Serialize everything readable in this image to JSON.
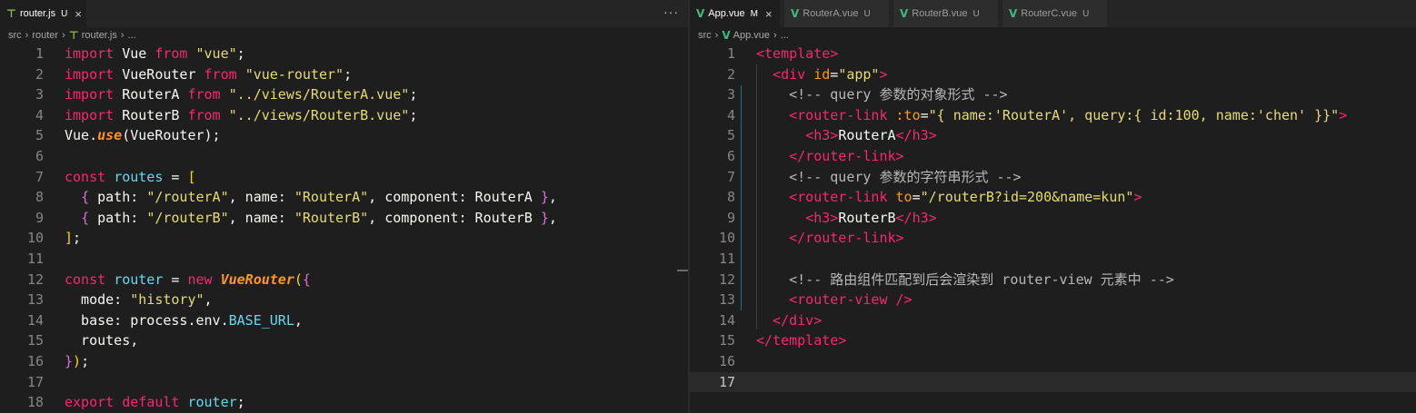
{
  "left": {
    "tabs": [
      {
        "name": "router.js",
        "status": "U",
        "active": true,
        "icon": "js-file-icon"
      }
    ],
    "more": "···",
    "breadcrumb": [
      "src",
      "router",
      "router.js",
      "..."
    ],
    "lines": [
      [
        {
          "t": "import",
          "c": "k"
        },
        {
          "t": " Vue ",
          "c": "v"
        },
        {
          "t": "from",
          "c": "k"
        },
        {
          "t": " ",
          "c": "v"
        },
        {
          "t": "\"vue\"",
          "c": "s"
        },
        {
          "t": ";",
          "c": "p"
        }
      ],
      [
        {
          "t": "import",
          "c": "k"
        },
        {
          "t": " VueRouter ",
          "c": "v"
        },
        {
          "t": "from",
          "c": "k"
        },
        {
          "t": " ",
          "c": "v"
        },
        {
          "t": "\"vue-router\"",
          "c": "s"
        },
        {
          "t": ";",
          "c": "p"
        }
      ],
      [
        {
          "t": "import",
          "c": "k"
        },
        {
          "t": " RouterA ",
          "c": "v"
        },
        {
          "t": "from",
          "c": "k"
        },
        {
          "t": " ",
          "c": "v"
        },
        {
          "t": "\"../views/RouterA.vue\"",
          "c": "s"
        },
        {
          "t": ";",
          "c": "p"
        }
      ],
      [
        {
          "t": "import",
          "c": "k"
        },
        {
          "t": " RouterB ",
          "c": "v"
        },
        {
          "t": "from",
          "c": "k"
        },
        {
          "t": " ",
          "c": "v"
        },
        {
          "t": "\"../views/RouterB.vue\"",
          "c": "s"
        },
        {
          "t": ";",
          "c": "p"
        }
      ],
      [
        {
          "t": "Vue.",
          "c": "v"
        },
        {
          "t": "use",
          "c": "fn"
        },
        {
          "t": "(VueRouter);",
          "c": "p"
        }
      ],
      [],
      [
        {
          "t": "const",
          "c": "k"
        },
        {
          "t": " ",
          "c": "v"
        },
        {
          "t": "routes",
          "c": "cl"
        },
        {
          "t": " = ",
          "c": "v"
        },
        {
          "t": "[",
          "c": "br1"
        }
      ],
      [
        {
          "t": "  ",
          "c": "v"
        },
        {
          "t": "{",
          "c": "br2"
        },
        {
          "t": " path: ",
          "c": "v"
        },
        {
          "t": "\"/routerA\"",
          "c": "s"
        },
        {
          "t": ", name: ",
          "c": "v"
        },
        {
          "t": "\"RouterA\"",
          "c": "s"
        },
        {
          "t": ", component: RouterA ",
          "c": "v"
        },
        {
          "t": "}",
          "c": "br2"
        },
        {
          "t": ",",
          "c": "p"
        }
      ],
      [
        {
          "t": "  ",
          "c": "v"
        },
        {
          "t": "{",
          "c": "br2"
        },
        {
          "t": " path: ",
          "c": "v"
        },
        {
          "t": "\"/routerB\"",
          "c": "s"
        },
        {
          "t": ", name: ",
          "c": "v"
        },
        {
          "t": "\"RouterB\"",
          "c": "s"
        },
        {
          "t": ", component: RouterB ",
          "c": "v"
        },
        {
          "t": "}",
          "c": "br2"
        },
        {
          "t": ",",
          "c": "p"
        }
      ],
      [
        {
          "t": "]",
          "c": "br1"
        },
        {
          "t": ";",
          "c": "p"
        }
      ],
      [],
      [
        {
          "t": "const",
          "c": "k"
        },
        {
          "t": " ",
          "c": "v"
        },
        {
          "t": "router",
          "c": "cl"
        },
        {
          "t": " = ",
          "c": "v"
        },
        {
          "t": "new",
          "c": "k"
        },
        {
          "t": " ",
          "c": "v"
        },
        {
          "t": "VueRouter",
          "c": "fn"
        },
        {
          "t": "(",
          "c": "br1"
        },
        {
          "t": "{",
          "c": "br2"
        }
      ],
      [
        {
          "t": "  mode: ",
          "c": "v"
        },
        {
          "t": "\"history\"",
          "c": "s"
        },
        {
          "t": ",",
          "c": "p"
        }
      ],
      [
        {
          "t": "  base: process.env.",
          "c": "v"
        },
        {
          "t": "BASE_URL",
          "c": "kb"
        },
        {
          "t": ",",
          "c": "p"
        }
      ],
      [
        {
          "t": "  routes,",
          "c": "v"
        }
      ],
      [
        {
          "t": "}",
          "c": "br2"
        },
        {
          "t": ")",
          "c": "br1"
        },
        {
          "t": ";",
          "c": "p"
        }
      ],
      [],
      [
        {
          "t": "export",
          "c": "k"
        },
        {
          "t": " ",
          "c": "v"
        },
        {
          "t": "default",
          "c": "k"
        },
        {
          "t": " ",
          "c": "v"
        },
        {
          "t": "router",
          "c": "cl"
        },
        {
          "t": ";",
          "c": "p"
        }
      ]
    ]
  },
  "right": {
    "tabs": [
      {
        "name": "App.vue",
        "status": "M",
        "active": true,
        "icon": "vue-file-icon"
      },
      {
        "name": "RouterA.vue",
        "status": "U",
        "active": false,
        "icon": "vue-file-icon"
      },
      {
        "name": "RouterB.vue",
        "status": "U",
        "active": false,
        "icon": "vue-file-icon"
      },
      {
        "name": "RouterC.vue",
        "status": "U",
        "active": false,
        "icon": "vue-file-icon"
      }
    ],
    "breadcrumb": [
      "src",
      "App.vue",
      "..."
    ],
    "lines": [
      [
        {
          "t": "<template>",
          "c": "tg"
        }
      ],
      [
        {
          "t": "  ",
          "c": "v"
        },
        {
          "t": "<div",
          "c": "tg"
        },
        {
          "t": " ",
          "c": "v"
        },
        {
          "t": "id",
          "c": "at"
        },
        {
          "t": "=",
          "c": "v"
        },
        {
          "t": "\"app\"",
          "c": "s"
        },
        {
          "t": ">",
          "c": "tg"
        }
      ],
      [
        {
          "t": "    ",
          "c": "v"
        },
        {
          "t": "<!-- query 参数的对象形式 -->",
          "c": "cm"
        }
      ],
      [
        {
          "t": "    ",
          "c": "v"
        },
        {
          "t": "<router-link",
          "c": "tg"
        },
        {
          "t": " ",
          "c": "v"
        },
        {
          "t": ":to",
          "c": "at"
        },
        {
          "t": "=",
          "c": "v"
        },
        {
          "t": "\"{ name:'RouterA', query:{ id:100, name:'chen' }}\"",
          "c": "s"
        },
        {
          "t": ">",
          "c": "tg"
        }
      ],
      [
        {
          "t": "      ",
          "c": "v"
        },
        {
          "t": "<h3>",
          "c": "tg"
        },
        {
          "t": "RouterA",
          "c": "v"
        },
        {
          "t": "</h3>",
          "c": "tg"
        }
      ],
      [
        {
          "t": "    ",
          "c": "v"
        },
        {
          "t": "</router-link>",
          "c": "tg"
        }
      ],
      [
        {
          "t": "    ",
          "c": "v"
        },
        {
          "t": "<!-- query 参数的字符串形式 -->",
          "c": "cm"
        }
      ],
      [
        {
          "t": "    ",
          "c": "v"
        },
        {
          "t": "<router-link",
          "c": "tg"
        },
        {
          "t": " ",
          "c": "v"
        },
        {
          "t": "to",
          "c": "at"
        },
        {
          "t": "=",
          "c": "v"
        },
        {
          "t": "\"/routerB?id=200&name=kun\"",
          "c": "s"
        },
        {
          "t": ">",
          "c": "tg"
        }
      ],
      [
        {
          "t": "      ",
          "c": "v"
        },
        {
          "t": "<h3>",
          "c": "tg"
        },
        {
          "t": "RouterB",
          "c": "v"
        },
        {
          "t": "</h3>",
          "c": "tg"
        }
      ],
      [
        {
          "t": "    ",
          "c": "v"
        },
        {
          "t": "</router-link>",
          "c": "tg"
        }
      ],
      [],
      [
        {
          "t": "    ",
          "c": "v"
        },
        {
          "t": "<!-- 路由组件匹配到后会渲染到 router-view 元素中 -->",
          "c": "cm"
        }
      ],
      [
        {
          "t": "    ",
          "c": "v"
        },
        {
          "t": "<router-view />",
          "c": "tg"
        }
      ],
      [
        {
          "t": "  ",
          "c": "v"
        },
        {
          "t": "</div>",
          "c": "tg"
        }
      ],
      [
        {
          "t": "</template>",
          "c": "tg"
        }
      ],
      [],
      []
    ]
  }
}
